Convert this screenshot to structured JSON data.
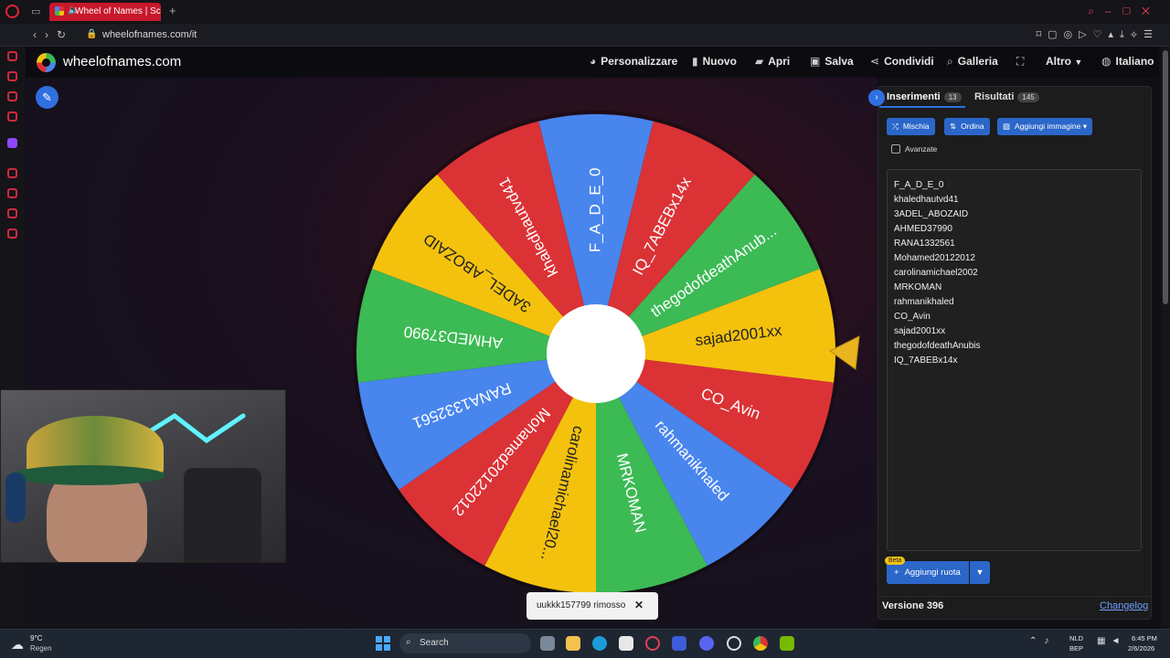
{
  "browser": {
    "tab_title": "Wheel of Names | Scel",
    "url": "wheelofnames.com/it"
  },
  "site": {
    "name": "wheelofnames.com",
    "menu": [
      {
        "label": "Personalizzare",
        "icon": "palette-icon"
      },
      {
        "label": "Nuovo",
        "icon": "file-icon"
      },
      {
        "label": "Apri",
        "icon": "folder-icon"
      },
      {
        "label": "Salva",
        "icon": "save-icon"
      },
      {
        "label": "Condividi",
        "icon": "share-icon"
      },
      {
        "label": "Galleria",
        "icon": "search-icon"
      },
      {
        "label": "",
        "icon": "fullscreen-icon"
      },
      {
        "label": "Altro",
        "icon": "chevron-down-icon"
      },
      {
        "label": "Italiano",
        "icon": "globe-icon"
      }
    ]
  },
  "wheel": {
    "entries": [
      "F_A_D_E_0",
      "IQ_7ABEBx14x",
      "thegodofdeathAnub...",
      "sajad2001xx",
      "CO_Avin",
      "rahmanikhaled",
      "MRKOMAN",
      "carolinamichael20...",
      "Mohamed20122012",
      "RANA1332561",
      "AHMED37990",
      "3ADEL_ABOZAID",
      "khaledhautvd41"
    ],
    "colors": [
      "#4885ed",
      "#db3236",
      "#3cba54",
      "#f4c20d",
      "#db3236",
      "#4885ed",
      "#3cba54",
      "#f4c20d",
      "#db3236",
      "#4885ed",
      "#3cba54",
      "#f4c20d",
      "#db3236"
    ]
  },
  "toast": {
    "message": "uukkk157799 rimosso"
  },
  "panel": {
    "tabs": [
      {
        "label": "Inserimenti",
        "count": "13"
      },
      {
        "label": "Risultati",
        "count": "145"
      }
    ],
    "buttons": {
      "shuffle": "Mischia",
      "sort": "Ordina",
      "add_image": "Aggiungi immagine"
    },
    "advanced_label": "Avanzate",
    "entries": [
      "F_A_D_E_0",
      "khaledhautvd41",
      "3ADEL_ABOZAID",
      "AHMED37990",
      "RANA1332561",
      "Mohamed20122012",
      "carolinamichael2002",
      "MRKOMAN",
      "rahmanikhaled",
      "CO_Avin",
      "sajad2001xx",
      "thegodofdeathAnubis",
      "IQ_7ABEBx14x"
    ],
    "beta_badge": "Beta",
    "add_wheel": "Aggiungi ruota",
    "version": "Versione 396",
    "changelog": "Changelog"
  },
  "taskbar": {
    "weather_temp": "9°C",
    "weather_desc": "Regen",
    "search_placeholder": "Search",
    "lang_line1": "NLD",
    "lang_line2": "BEP",
    "time": "6:45 PM",
    "date": "2/6/2026"
  }
}
